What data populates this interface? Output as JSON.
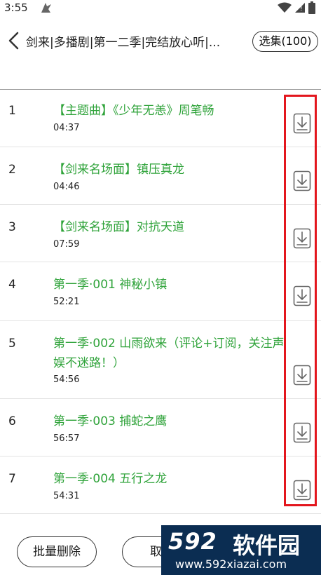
{
  "status": {
    "time": "3:55"
  },
  "header": {
    "title": "剑来|多播剧|第一二季|完结放心听|...",
    "select_label": "选集(100)"
  },
  "episodes": [
    {
      "num": "1",
      "title": "【主题曲】《少年无恙》周笔畅",
      "duration": "04:37"
    },
    {
      "num": "2",
      "title": "【剑来名场面】镇压真龙",
      "duration": "04:46"
    },
    {
      "num": "3",
      "title": "【剑来名场面】对抗天道",
      "duration": "07:59"
    },
    {
      "num": "4",
      "title": "第一季·001 神秘小镇",
      "duration": "52:21"
    },
    {
      "num": "5",
      "title": "第一季·002 山雨欲来（评论+订阅，关注声娱不迷路！）",
      "duration": "54:56"
    },
    {
      "num": "6",
      "title": "第一季·003 捕蛇之鹰",
      "duration": "56:57"
    },
    {
      "num": "7",
      "title": "第一季·004 五行之龙",
      "duration": "54:31"
    }
  ],
  "footer": {
    "batch_delete_label": "批量删除",
    "cancel_label": "取消"
  },
  "watermark": {
    "number": "592",
    "name": "软件园",
    "url": "www.592xiazai.com"
  },
  "colors": {
    "title_green": "#2fa33a",
    "highlight_red": "#e3161d",
    "watermark_bg": "#0b2d52"
  },
  "icons": [
    "back-arrow-icon",
    "download-icon",
    "wifi-icon",
    "signal-icon",
    "battery-icon"
  ]
}
